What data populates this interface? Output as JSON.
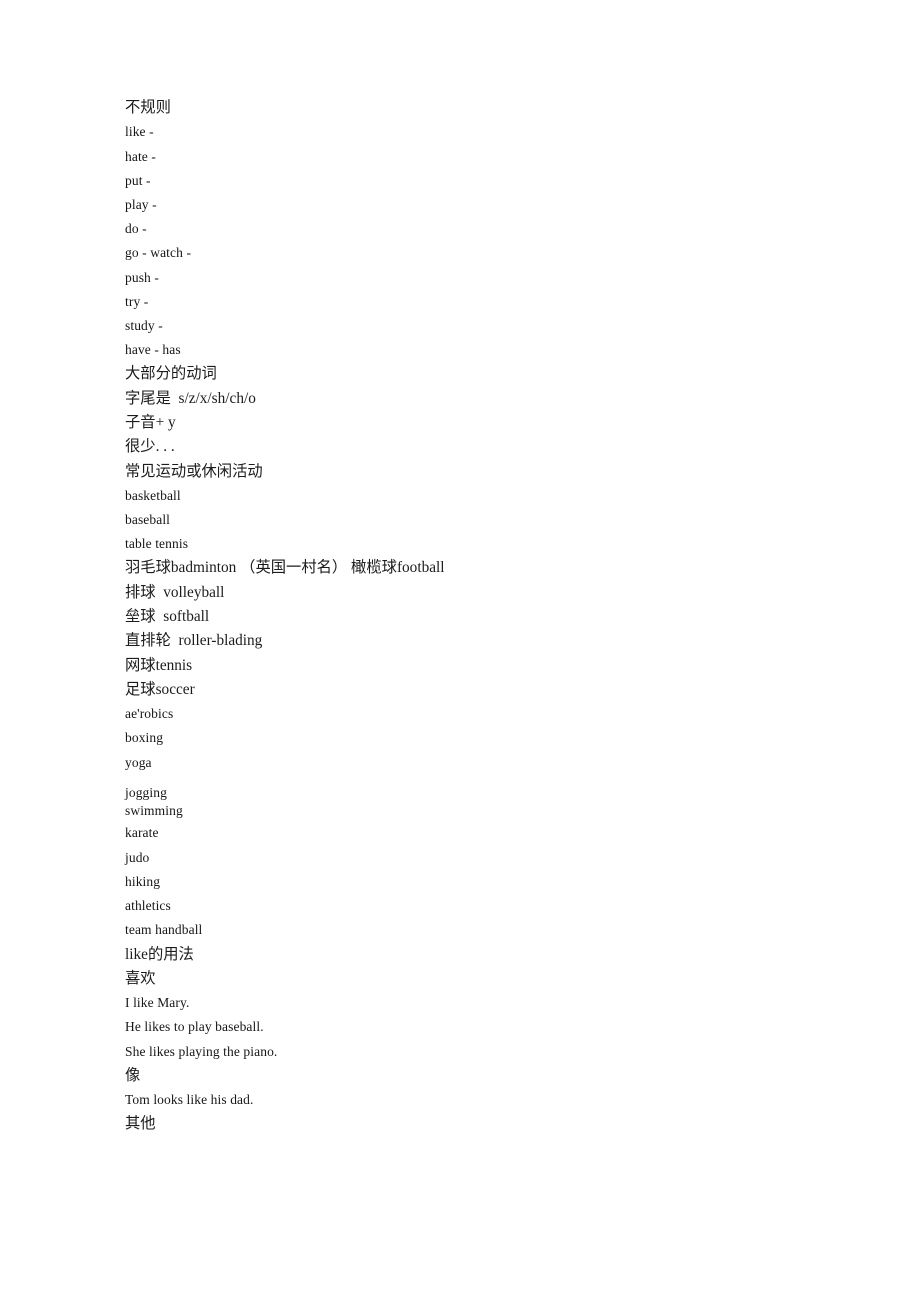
{
  "document": {
    "page_background": "#ffffff",
    "text_color": "#161616",
    "sections": [
      {
        "id": "irregular-verbs",
        "heading": "不规则",
        "lines": [
          "like -",
          "hate -",
          "put -",
          "play -",
          "do -",
          "go - watch -",
          "push -",
          "try -",
          "study -",
          "have - has"
        ]
      },
      {
        "id": "verb-rules",
        "lines": [
          "大部分的动词",
          "字尾是  s/z/x/sh/ch/o",
          "子音+ y",
          "很少. . .",
          "常见运动或休闲活动"
        ]
      },
      {
        "id": "sports",
        "lines": [
          "basketball",
          "baseball",
          "table tennis",
          "羽毛球badminton （英国一村名） 橄榄球football",
          "排球  volleyball",
          "垒球  softball",
          "直排轮  roller-blading",
          "网球tennis",
          "足球soccer",
          "ae'robics",
          "boxing",
          "yoga",
          "jogging",
          "swimming",
          "karate",
          "judo",
          "hiking",
          "athletics",
          "team handball"
        ]
      },
      {
        "id": "like-usage",
        "heading": "like的用法",
        "subsections": [
          {
            "label": "喜欢",
            "examples": [
              "I like Mary.",
              "He likes to play baseball.",
              "She likes playing the piano."
            ]
          },
          {
            "label": "像",
            "examples": [
              "Tom looks like his dad."
            ]
          },
          {
            "label": "其他",
            "examples": []
          }
        ]
      }
    ]
  }
}
